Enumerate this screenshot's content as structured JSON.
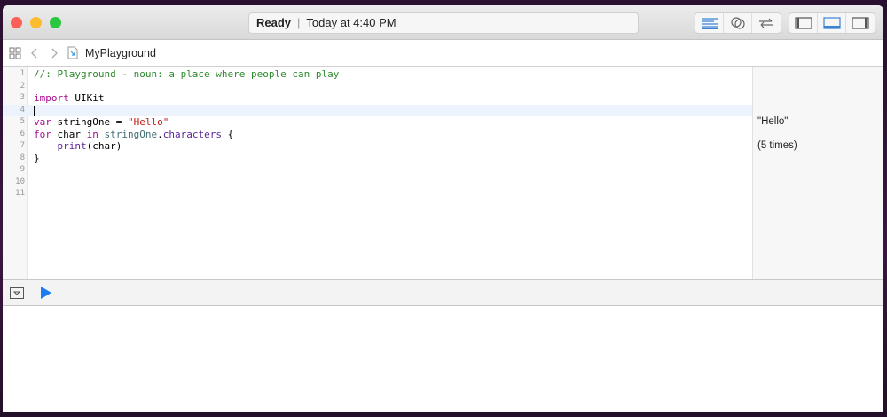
{
  "titlebar": {
    "status": "Ready",
    "timestamp": "Today at 4:40 PM"
  },
  "navbar": {
    "file_name": "MyPlayground"
  },
  "editor": {
    "lines": [
      {
        "n": "1",
        "tokens": [
          {
            "t": "//: Playground - noun: a place where people can play",
            "c": "com"
          }
        ]
      },
      {
        "n": "2",
        "tokens": []
      },
      {
        "n": "3",
        "tokens": [
          {
            "t": "import",
            "c": "kw"
          },
          {
            "t": " UIKit",
            "c": ""
          }
        ]
      },
      {
        "n": "4",
        "tokens": [],
        "current": true
      },
      {
        "n": "5",
        "tokens": [
          {
            "t": "var",
            "c": "kw"
          },
          {
            "t": " stringOne = ",
            "c": ""
          },
          {
            "t": "\"Hello\"",
            "c": "str"
          }
        ],
        "result": "\"Hello\""
      },
      {
        "n": "6",
        "tokens": [
          {
            "t": "for",
            "c": "kw"
          },
          {
            "t": " char ",
            "c": ""
          },
          {
            "t": "in",
            "c": "kw"
          },
          {
            "t": " ",
            "c": ""
          },
          {
            "t": "stringOne",
            "c": "var"
          },
          {
            "t": ".",
            "c": ""
          },
          {
            "t": "characters",
            "c": "fn"
          },
          {
            "t": " {",
            "c": ""
          }
        ]
      },
      {
        "n": "7",
        "tokens": [
          {
            "t": "    ",
            "c": ""
          },
          {
            "t": "print",
            "c": "fn"
          },
          {
            "t": "(char)",
            "c": ""
          }
        ],
        "result": "(5 times)"
      },
      {
        "n": "8",
        "tokens": [
          {
            "t": "}",
            "c": ""
          }
        ]
      },
      {
        "n": "9",
        "tokens": []
      },
      {
        "n": "10",
        "tokens": []
      },
      {
        "n": "11",
        "tokens": []
      }
    ]
  },
  "colors": {
    "accent": "#1a7cf0",
    "comment": "#2e8a2e",
    "keyword": "#aa0d91",
    "string": "#c41a16"
  }
}
